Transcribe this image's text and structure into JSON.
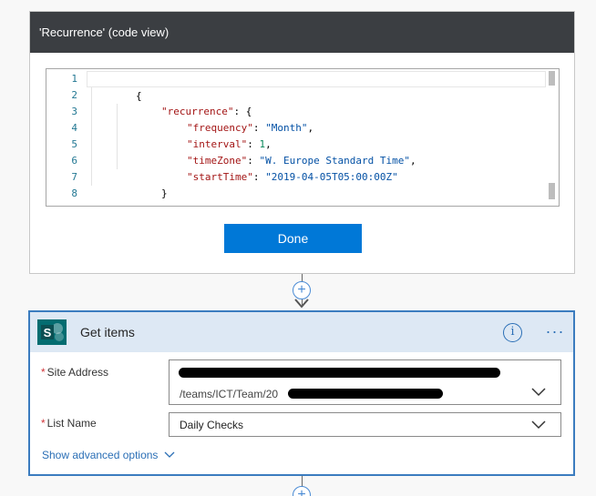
{
  "recurrence_card": {
    "title": "'Recurrence' (code view)",
    "done_label": "Done",
    "code": {
      "line_numbers": [
        "1",
        "2",
        "3",
        "4",
        "5",
        "6",
        "7",
        "8"
      ],
      "line1": "{",
      "line2_key": "\"recurrence\"",
      "line2_rest": ": {",
      "line3_key": "\"frequency\"",
      "line3_value": "\"Month\"",
      "line4_key": "\"interval\"",
      "line4_value": "1",
      "line5_key": "\"timeZone\"",
      "line5_value": "\"W. Europe Standard Time\"",
      "line6_key": "\"startTime\"",
      "line6_value": "\"2019-04-05T05:00:00Z\"",
      "line7": "}",
      "line8": "}",
      "sep": ": ",
      "comma": ","
    }
  },
  "connector": {
    "plus_symbol": "+"
  },
  "get_items_card": {
    "title": "Get items",
    "info_symbol": "i",
    "more_symbol": "···",
    "site_address": {
      "label": "Site Address",
      "value_line2_visible": "/teams/ICT/Team/20"
    },
    "list_name": {
      "label": "List Name",
      "value": "Daily Checks"
    },
    "show_advanced_label": "Show advanced options",
    "required_mark": "*"
  },
  "colors": {
    "header_dark": "#3b3e42",
    "primary_button": "#0078d7",
    "card_border_blue": "#3b7cbf",
    "card_header_blue": "#dde8f4",
    "sharepoint_teal": "#036c70",
    "required_red": "#d13438"
  },
  "icons": {
    "add_step": "plus-circle-icon",
    "sharepoint": "sharepoint-icon",
    "info": "info-icon",
    "more": "ellipsis-icon",
    "dropdown": "chevron-down-icon",
    "connector_arrow": "arrow-down-icon"
  }
}
